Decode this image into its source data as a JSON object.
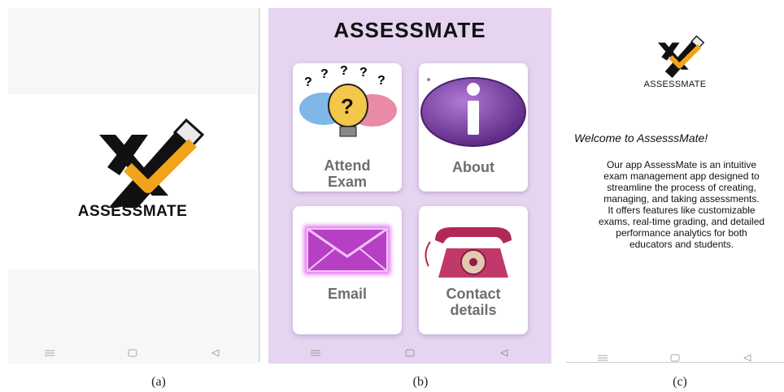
{
  "panel_a": {
    "logo_text": "ASSESSMATE",
    "caption": "(a)"
  },
  "panel_b": {
    "title": "ASSESSMATE",
    "cards": [
      {
        "label": "Attend Exam",
        "icon": "question-lightbulb-icon"
      },
      {
        "label": "About",
        "icon": "info-icon"
      },
      {
        "label": "Email",
        "icon": "envelope-icon"
      },
      {
        "label": "Contact details",
        "icon": "telephone-icon"
      }
    ],
    "caption": "(b)"
  },
  "panel_c": {
    "logo_text": "ASSESSMATE",
    "welcome": "Welcome to AssesssMate!",
    "body": "Our app AssessMate is an intuitive\nexam management app designed to\nstreamline the process of creating,\nmanaging, and taking assessments.\nIt offers features like customizable\nexams, real-time grading, and detailed\nperformance analytics for both\neducators and students.",
    "caption": "(c)"
  },
  "colors": {
    "panel_b_bg": "#e6d4f1",
    "check_orange": "#f2a31b",
    "info_purple": "#7b3fa6"
  }
}
